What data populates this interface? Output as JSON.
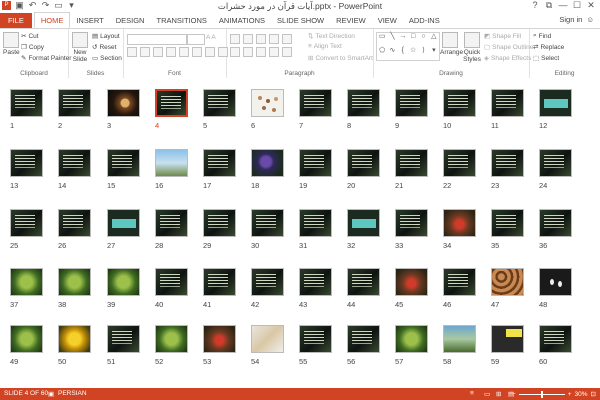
{
  "title": "آیات قرآن در مورد حشرات.pptx - PowerPoint",
  "quick_access": [
    "save-icon",
    "undo-icon",
    "redo-icon",
    "start-from-beginning-icon",
    "customize-icon"
  ],
  "window_controls": [
    "?",
    "⧉",
    "—",
    "☐",
    "✕"
  ],
  "tabs": [
    "FILE",
    "HOME",
    "INSERT",
    "DESIGN",
    "TRANSITIONS",
    "ANIMATIONS",
    "SLIDE SHOW",
    "REVIEW",
    "VIEW",
    "ADD-INS"
  ],
  "active_tab": "HOME",
  "signin": "Sign in",
  "ribbon": {
    "clipboard": {
      "label": "Clipboard",
      "paste": "Paste",
      "cut": "Cut",
      "copy": "Copy",
      "format_painter": "Format Painter"
    },
    "slides": {
      "label": "Slides",
      "new_slide": "New Slide",
      "layout": "Layout",
      "reset": "Reset",
      "section": "Section"
    },
    "font": {
      "label": "Font"
    },
    "paragraph": {
      "label": "Paragraph",
      "text_direction": "Text Direction",
      "align_text": "Align Text",
      "convert_smartart": "Convert to SmartArt"
    },
    "drawing": {
      "label": "Drawing",
      "arrange": "Arrange",
      "quick_styles": "Quick Styles",
      "shape_fill": "Shape Fill",
      "shape_outline": "Shape Outline",
      "shape_effects": "Shape Effects"
    },
    "editing": {
      "label": "Editing",
      "find": "Find",
      "replace": "Replace",
      "select": "Select"
    }
  },
  "slides": [
    {
      "n": "1",
      "style": "dark"
    },
    {
      "n": "2",
      "style": "dark"
    },
    {
      "n": "3",
      "style": "photo-bug"
    },
    {
      "n": "4",
      "style": "dark",
      "selected": true
    },
    {
      "n": "5",
      "style": "dark"
    },
    {
      "n": "6",
      "style": "light"
    },
    {
      "n": "7",
      "style": "dark"
    },
    {
      "n": "8",
      "style": "dark"
    },
    {
      "n": "9",
      "style": "dark"
    },
    {
      "n": "10",
      "style": "dark"
    },
    {
      "n": "11",
      "style": "dark"
    },
    {
      "n": "12",
      "style": "teal"
    },
    {
      "n": "13",
      "style": "dark"
    },
    {
      "n": "14",
      "style": "dark"
    },
    {
      "n": "15",
      "style": "dark"
    },
    {
      "n": "16",
      "style": "sky"
    },
    {
      "n": "17",
      "style": "dark"
    },
    {
      "n": "18",
      "style": "flower"
    },
    {
      "n": "19",
      "style": "dark"
    },
    {
      "n": "20",
      "style": "dark"
    },
    {
      "n": "21",
      "style": "dark"
    },
    {
      "n": "22",
      "style": "dark"
    },
    {
      "n": "23",
      "style": "dark"
    },
    {
      "n": "24",
      "style": "dark"
    },
    {
      "n": "25",
      "style": "dark"
    },
    {
      "n": "26",
      "style": "dark"
    },
    {
      "n": "27",
      "style": "teal"
    },
    {
      "n": "28",
      "style": "dark"
    },
    {
      "n": "29",
      "style": "dark"
    },
    {
      "n": "30",
      "style": "dark"
    },
    {
      "n": "31",
      "style": "dark"
    },
    {
      "n": "32",
      "style": "teal"
    },
    {
      "n": "33",
      "style": "dark"
    },
    {
      "n": "34",
      "style": "red"
    },
    {
      "n": "35",
      "style": "dark"
    },
    {
      "n": "36",
      "style": "dark"
    },
    {
      "n": "37",
      "style": "green"
    },
    {
      "n": "38",
      "style": "green"
    },
    {
      "n": "39",
      "style": "green"
    },
    {
      "n": "40",
      "style": "dark"
    },
    {
      "n": "41",
      "style": "dark"
    },
    {
      "n": "42",
      "style": "dark"
    },
    {
      "n": "43",
      "style": "dark"
    },
    {
      "n": "44",
      "style": "dark"
    },
    {
      "n": "45",
      "style": "red"
    },
    {
      "n": "46",
      "style": "dark"
    },
    {
      "n": "47",
      "style": "brown"
    },
    {
      "n": "48",
      "style": "white-dots"
    },
    {
      "n": "49",
      "style": "green"
    },
    {
      "n": "50",
      "style": "yellow"
    },
    {
      "n": "51",
      "style": "dark"
    },
    {
      "n": "52",
      "style": "green"
    },
    {
      "n": "53",
      "style": "red"
    },
    {
      "n": "54",
      "style": "mixed"
    },
    {
      "n": "55",
      "style": "dark"
    },
    {
      "n": "56",
      "style": "dark"
    },
    {
      "n": "57",
      "style": "green"
    },
    {
      "n": "58",
      "style": "landscape"
    },
    {
      "n": "59",
      "style": "yellowbox"
    },
    {
      "n": "60",
      "style": "dark"
    }
  ],
  "status": {
    "slide_of": "SLIDE 4 OF 60",
    "language": "PERSIAN",
    "zoom": "30%"
  }
}
